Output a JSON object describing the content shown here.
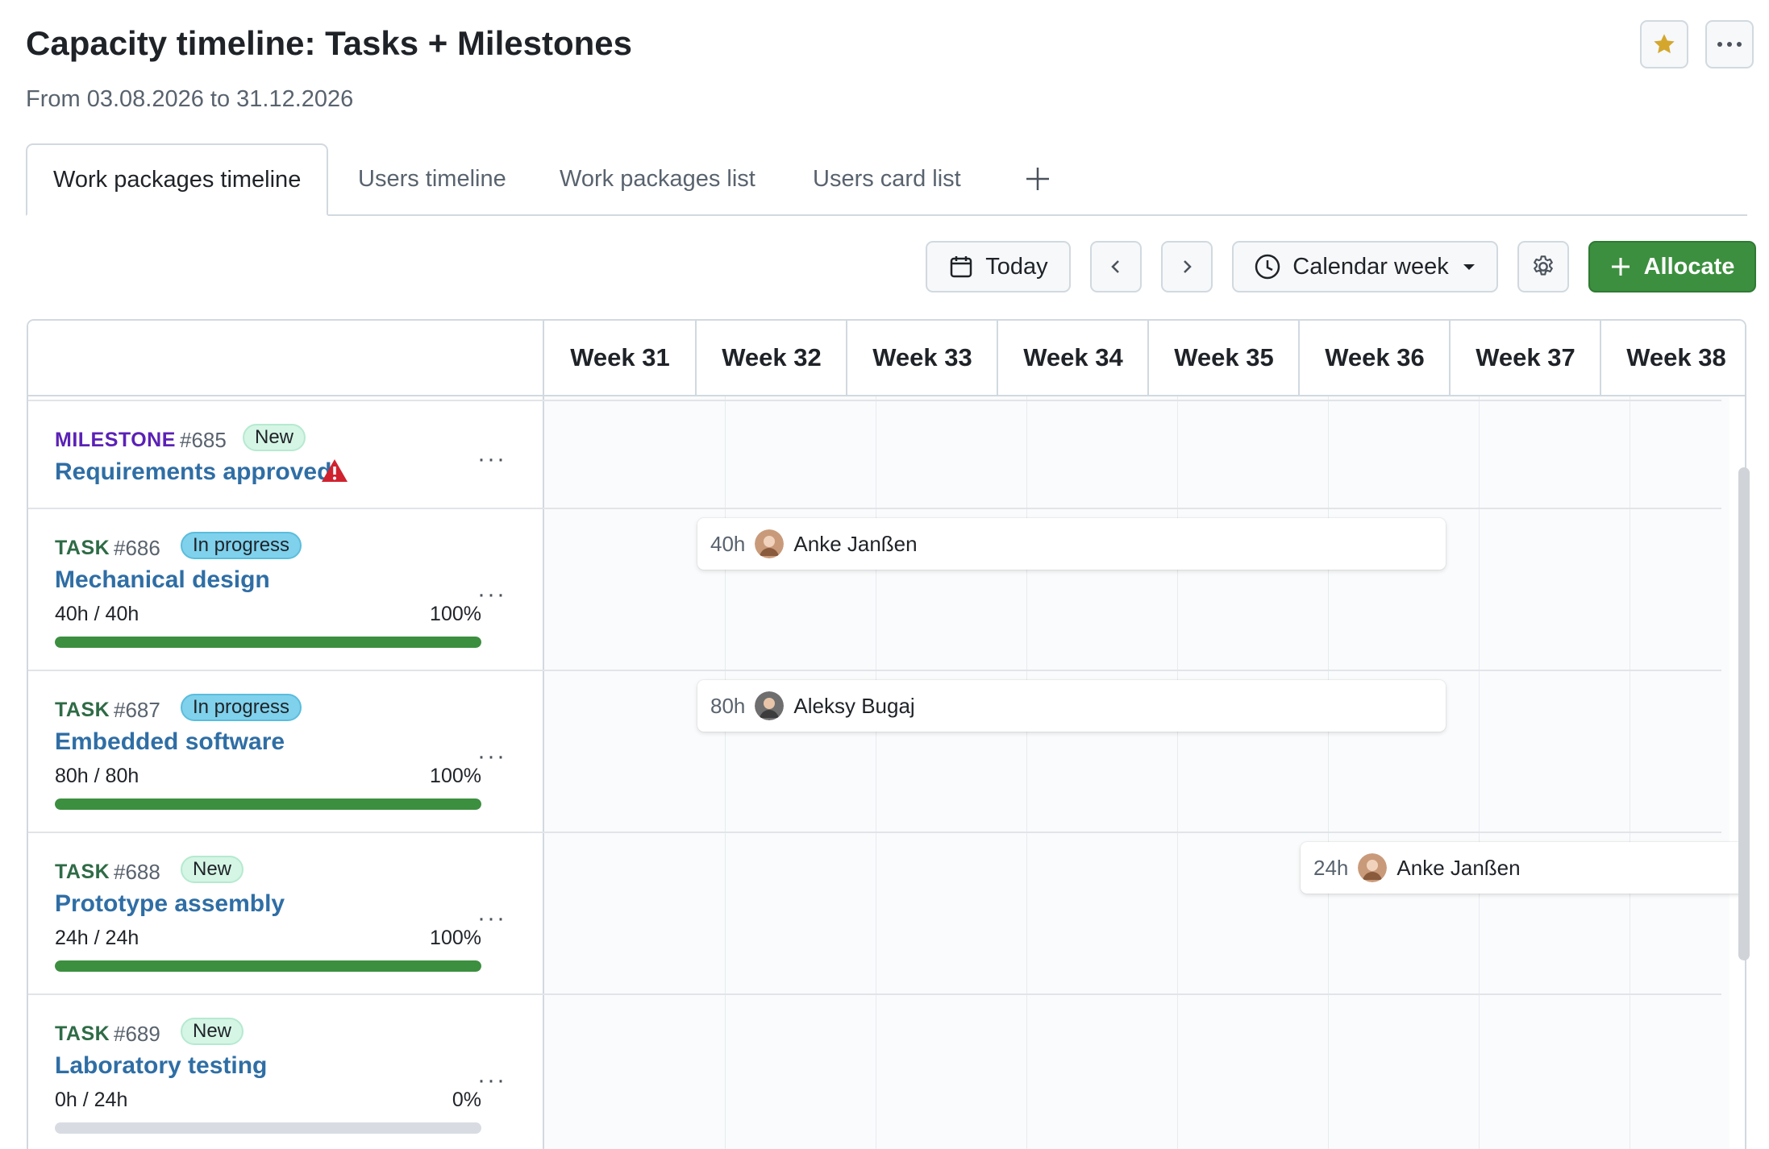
{
  "header": {
    "title": "Capacity timeline: Tasks + Milestones",
    "subtitle": "From 03.08.2026 to 31.12.2026",
    "favorite_icon": "star-icon",
    "more_icon": "more-horizontal-icon"
  },
  "tabs": [
    {
      "label": "Work packages timeline",
      "active": true
    },
    {
      "label": "Users timeline",
      "active": false
    },
    {
      "label": "Work packages list",
      "active": false
    },
    {
      "label": "Users card list",
      "active": false
    }
  ],
  "toolbar": {
    "today_label": "Today",
    "period_label": "Calendar week",
    "allocate_label": "Allocate"
  },
  "weeks": [
    "Week 31",
    "Week 32",
    "Week 33",
    "Week 34",
    "Week 35",
    "Week 36",
    "Week 37",
    "Week 38"
  ],
  "rows": [
    {
      "type": "MILESTONE",
      "id": "#685",
      "status": "New",
      "title": "Requirements approved",
      "warning": true
    },
    {
      "type": "TASK",
      "id": "#686",
      "status": "In progress",
      "title": "Mechanical design",
      "hours": "40h / 40h",
      "percent": "100%",
      "progress": 1.0
    },
    {
      "type": "TASK",
      "id": "#687",
      "status": "In progress",
      "title": "Embedded software",
      "hours": "80h / 80h",
      "percent": "100%",
      "progress": 1.0
    },
    {
      "type": "TASK",
      "id": "#688",
      "status": "New",
      "title": "Prototype assembly",
      "hours": "24h / 24h",
      "percent": "100%",
      "progress": 1.0
    },
    {
      "type": "TASK",
      "id": "#689",
      "status": "New",
      "title": "Laboratory testing",
      "hours": "0h / 24h",
      "percent": "0%",
      "progress": 0.0
    }
  ],
  "allocations": [
    {
      "hours": "40h",
      "user": "Anke Janßen"
    },
    {
      "hours": "80h",
      "user": "Aleksy Bugaj"
    },
    {
      "hours": "24h",
      "user": "Anke Janßen"
    }
  ],
  "colors": {
    "milestone_type": "#5b21b6",
    "task_type": "#2e6b46",
    "link": "#2f6ea5",
    "progress_fill": "#3c8f3f",
    "primary_button": "#3c8f3f",
    "warning": "#cf222e",
    "star": "#d4a72c"
  }
}
